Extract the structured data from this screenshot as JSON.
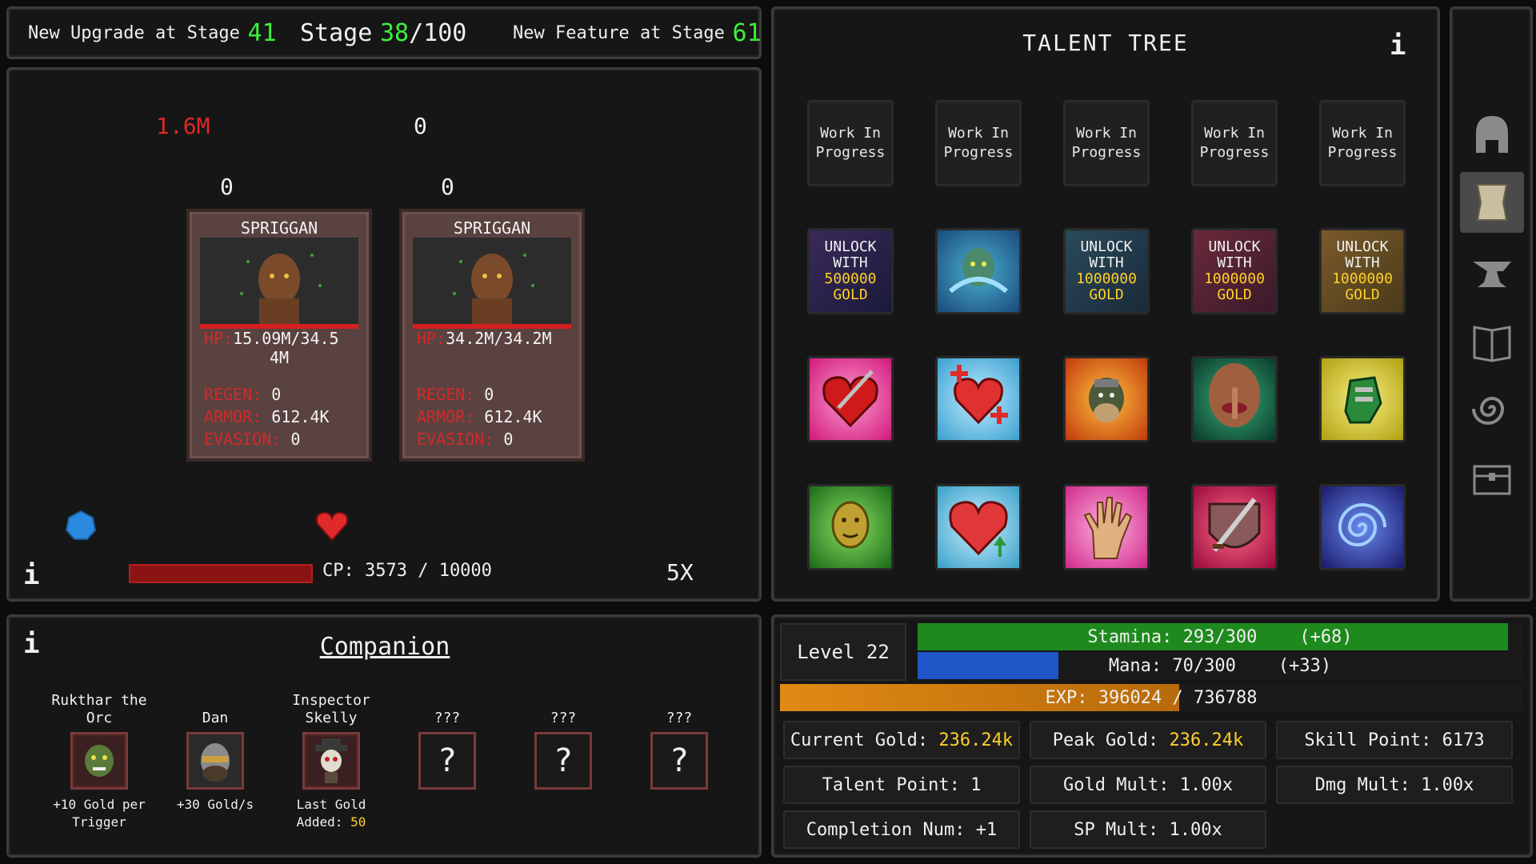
{
  "stage_bar": {
    "upgrade_label": "New Upgrade at Stage",
    "upgrade_stage": "41",
    "stage_label": "Stage",
    "stage_current": "38",
    "stage_total": "/100",
    "feature_label": "New Feature at Stage",
    "feature_stage": "61"
  },
  "battle": {
    "damage_left": "1.6M",
    "damage_right": "0",
    "counter_1": "0",
    "counter_2": "0",
    "enemies": [
      {
        "name": "SPRIGGAN",
        "hp_label": "HP:",
        "hp_value": "15.09M/34.5",
        "hp_value_wrap": "4M",
        "regen_label": "REGEN:",
        "regen_value": "0",
        "armor_label": "ARMOR:",
        "armor_value": "612.4K",
        "evasion_label": "EVASION:",
        "evasion_value": "0"
      },
      {
        "name": "SPRIGGAN",
        "hp_label": "HP:",
        "hp_value": "34.2M/34.2M",
        "regen_label": "REGEN:",
        "regen_value": "0",
        "armor_label": "ARMOR:",
        "armor_value": "612.4K",
        "evasion_label": "EVASION:",
        "evasion_value": "0"
      }
    ],
    "info_icon": "i",
    "cp_text": "CP: 3573 / 10000",
    "cp_fraction": 0.3573,
    "speed": "5X"
  },
  "companion": {
    "info_icon": "i",
    "title": "Companion",
    "slots": [
      {
        "name": "Rukthar the Orc",
        "desc": "+10 Gold per Trigger"
      },
      {
        "name": "Dan",
        "desc": "+30 Gold/s"
      },
      {
        "name": "Inspector Skelly",
        "desc": "Last Gold Added:",
        "desc_value": "50"
      },
      {
        "name": "???",
        "placeholder": "?"
      },
      {
        "name": "???",
        "placeholder": "?"
      },
      {
        "name": "???",
        "placeholder": "?"
      }
    ]
  },
  "talent_tree": {
    "title": "TALENT TREE",
    "info_icon": "i",
    "wip": [
      "Work In Progress",
      "Work In Progress",
      "Work In Progress",
      "Work In Progress",
      "Work In Progress"
    ],
    "locks": [
      {
        "line1": "UNLOCK",
        "line2": "WITH",
        "amount": "500000",
        "unit": "GOLD"
      },
      {
        "line1": "UNLOCK",
        "line2": "WITH",
        "amount": "1000000",
        "unit": "GOLD"
      },
      {
        "line1": "UNLOCK",
        "line2": "WITH",
        "amount": "1000000",
        "unit": "GOLD"
      },
      {
        "line1": "UNLOCK",
        "line2": "WITH",
        "amount": "1000000",
        "unit": "GOLD"
      }
    ],
    "icons": [
      "water-elemental-icon",
      "pierced-heart-icon",
      "healing-heart-icon",
      "dwarf-warrior-icon",
      "silence-lips-icon",
      "gauntlet-icon",
      "golden-head-icon",
      "heart-up-icon",
      "open-hand-icon",
      "sword-shield-icon",
      "vortex-icon"
    ]
  },
  "side_nav": [
    "helmet-icon",
    "scroll-icon",
    "anvil-icon",
    "spellbook-icon",
    "spiral-icon",
    "chest-icon"
  ],
  "stats": {
    "level": "Level 22",
    "stamina_text": "Stamina: 293/300    (+68)",
    "stamina_fraction": 0.9767,
    "mana_text": "Mana: 70/300    (+33)",
    "mana_fraction": 0.2333,
    "exp_text": "EXP: 396024 / 736788",
    "exp_fraction": 0.5375,
    "current_gold_label": "Current Gold:",
    "current_gold_value": "236.24k",
    "peak_gold_label": "Peak Gold:",
    "peak_gold_value": "236.24k",
    "skill_point": "Skill Point: 6173",
    "talent_point": "Talent Point: 1",
    "gold_mult": "Gold Mult: 1.00x",
    "dmg_mult": "Dmg Mult: 1.00x",
    "completion": "Completion Num: +1",
    "sp_mult": "SP Mult: 1.00x"
  },
  "colors": {
    "accent_green": "#3df03d",
    "gold_yellow": "#ffd02a",
    "enemy_red": "#d12a2a",
    "stamina": "#1e8a1e",
    "mana": "#1e56c8",
    "exp": "#c87a14"
  }
}
